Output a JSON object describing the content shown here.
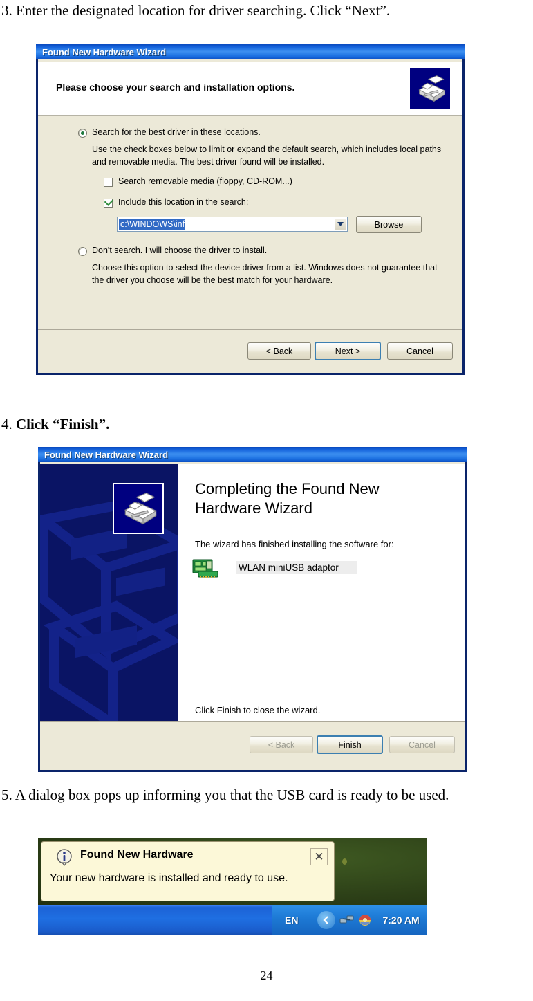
{
  "document": {
    "page_number": "24",
    "steps": [
      {
        "num": "3.",
        "text": " Enter the designated location for driver searching.    Click “Next”.",
        "bold": false
      },
      {
        "num": "4.",
        "text": " Click “Finish”.",
        "bold": true
      },
      {
        "num": "5.",
        "text": " A dialog box pops up informing you that the USB card is ready to be used.",
        "bold": false
      }
    ]
  },
  "dialog1": {
    "title": "Found New Hardware Wizard",
    "heading": "Please choose your search and installation options.",
    "wizard_icon": "hardware-wizard-icon",
    "option_search": {
      "label": "Search for the best driver in these locations.",
      "selected": true,
      "description": "Use the check boxes below to limit or expand the default search, which includes local paths and removable media. The best driver found will be installed."
    },
    "checkbox_removable": {
      "label": "Search removable media (floppy, CD-ROM...)",
      "checked": false
    },
    "checkbox_location": {
      "label": "Include this location in the search:",
      "checked": true
    },
    "location_value": "c:\\WINDOWS\\inf",
    "browse_label": "Browse",
    "option_dontsearch": {
      "label": "Don't search. I will choose the driver to install.",
      "selected": false,
      "description": "Choose this option to select the device driver from a list.  Windows does not guarantee that the driver you choose will be the best match for your hardware."
    },
    "buttons": {
      "back": "< Back",
      "next": "Next >",
      "cancel": "Cancel"
    }
  },
  "dialog2": {
    "title": "Found New Hardware Wizard",
    "heading_line1": "Completing the Found New",
    "heading_line2": "Hardware Wizard",
    "subtext": "The wizard has finished installing the software for:",
    "device_name": "WLAN miniUSB adaptor",
    "device_icon": "network-card-icon",
    "wizard_icon": "hardware-wizard-icon",
    "close_hint": "Click Finish to close the wizard.",
    "buttons": {
      "back": "< Back",
      "finish": "Finish",
      "cancel": "Cancel"
    }
  },
  "balloon": {
    "title": "Found New Hardware",
    "message": "Your new hardware is installed and ready to use.",
    "close_label": "✕",
    "info_icon": "info-icon",
    "tray": {
      "language": "EN",
      "clock": "7:20 AM",
      "icons": [
        "hide-icons-chevron",
        "network-icon",
        "volume-icon"
      ]
    }
  },
  "colors": {
    "title_bar": "#1563DC",
    "dialog_face": "#ECE9D8",
    "wizard_panel": "#0A1464",
    "selection_blue": "#316AC5",
    "taskbar_blue": "#1F6FE2",
    "balloon_bg": "#FCF8D8",
    "check_green": "#2E8B3A"
  }
}
